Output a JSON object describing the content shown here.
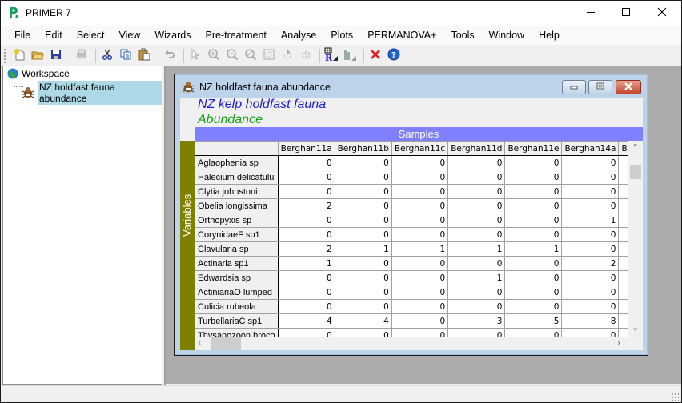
{
  "app": {
    "title": "PRIMER 7",
    "window_controls": {
      "minimize": "minimize-icon",
      "maximize": "maximize-icon",
      "close": "close-icon"
    }
  },
  "menubar": {
    "items": [
      "File",
      "Edit",
      "Select",
      "View",
      "Wizards",
      "Pre-treatment",
      "Analyse",
      "Plots",
      "PERMANOVA+",
      "Tools",
      "Window",
      "Help"
    ]
  },
  "toolbar": {
    "buttons": [
      {
        "icon": "new-file-icon",
        "enabled": true
      },
      {
        "icon": "open-folder-icon",
        "enabled": true
      },
      {
        "icon": "save-icon",
        "enabled": true
      },
      {
        "icon": "print-icon",
        "enabled": false
      },
      {
        "icon": "cut-icon",
        "enabled": true
      },
      {
        "icon": "copy-icon",
        "enabled": true
      },
      {
        "icon": "paste-icon",
        "enabled": true
      },
      {
        "icon": "undo-icon",
        "enabled": false
      },
      {
        "icon": "pointer-icon",
        "enabled": false
      },
      {
        "icon": "zoom-in-icon",
        "enabled": false
      },
      {
        "icon": "zoom-out-icon",
        "enabled": false
      },
      {
        "icon": "zoom-reset-icon",
        "enabled": false
      },
      {
        "icon": "select-region-icon",
        "enabled": false
      },
      {
        "icon": "rotate-icon",
        "enabled": false
      },
      {
        "icon": "flip-icon",
        "enabled": false
      },
      {
        "icon": "row-labels-icon",
        "enabled": true
      },
      {
        "icon": "column-labels-icon",
        "enabled": false
      },
      {
        "icon": "delete-icon",
        "enabled": true
      },
      {
        "icon": "help-icon",
        "enabled": true
      }
    ]
  },
  "workspace": {
    "root_label": "Workspace",
    "items": [
      {
        "label": "NZ holdfast fauna abundance",
        "selected": true
      }
    ]
  },
  "sheet": {
    "window_title": "NZ holdfast fauna abundance",
    "title_line1": "NZ kelp holdfast fauna",
    "title_line2": "Abundance",
    "samples_label": "Samples",
    "variables_label": "Variables",
    "colors": {
      "title1": "#1a1ad8",
      "title2": "#16a016",
      "samples_bar": "#8080ff",
      "variables_bar": "#808000",
      "selection": "#add8e6"
    },
    "columns": [
      "Berghan11a",
      "Berghan11b",
      "Berghan11c",
      "Berghan11d",
      "Berghan11e",
      "Berghan14a",
      "Berg"
    ],
    "rows": [
      {
        "name": "Aglaophenia sp",
        "values": [
          "0",
          "0",
          "0",
          "0",
          "0",
          "0"
        ]
      },
      {
        "name": "Halecium delicatulu",
        "values": [
          "0",
          "0",
          "0",
          "0",
          "0",
          "0"
        ]
      },
      {
        "name": "Clytia johnstoni",
        "values": [
          "0",
          "0",
          "0",
          "0",
          "0",
          "0"
        ]
      },
      {
        "name": "Obelia longissima",
        "values": [
          "2",
          "0",
          "0",
          "0",
          "0",
          "0"
        ]
      },
      {
        "name": "Orthopyxis sp",
        "values": [
          "0",
          "0",
          "0",
          "0",
          "0",
          "1"
        ]
      },
      {
        "name": "CorynidaeF sp1",
        "values": [
          "0",
          "0",
          "0",
          "0",
          "0",
          "0"
        ]
      },
      {
        "name": "Clavularia sp",
        "values": [
          "2",
          "1",
          "1",
          "1",
          "1",
          "0"
        ]
      },
      {
        "name": "Actinaria sp1",
        "values": [
          "1",
          "0",
          "0",
          "0",
          "0",
          "2"
        ]
      },
      {
        "name": "Edwardsia sp",
        "values": [
          "0",
          "0",
          "0",
          "1",
          "0",
          "0"
        ]
      },
      {
        "name": "ActiniariaO lumped",
        "values": [
          "0",
          "0",
          "0",
          "0",
          "0",
          "0"
        ]
      },
      {
        "name": "Culicia rubeola",
        "values": [
          "0",
          "0",
          "0",
          "0",
          "0",
          "0"
        ]
      },
      {
        "name": "TurbellariaC sp1",
        "values": [
          "4",
          "4",
          "0",
          "3",
          "5",
          "8"
        ]
      },
      {
        "name": "Thysanozoon broco",
        "values": [
          "0",
          "0",
          "0",
          "0",
          "0",
          "0"
        ]
      }
    ]
  }
}
